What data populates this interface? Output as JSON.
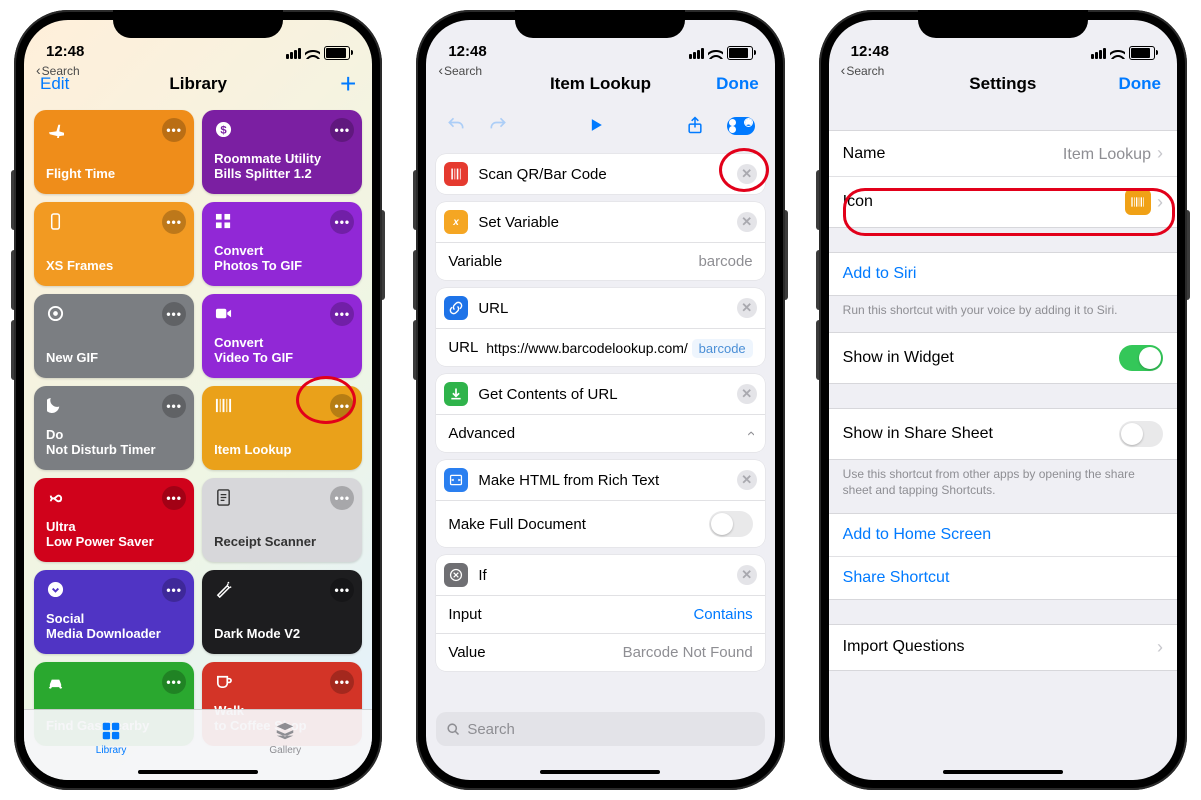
{
  "status": {
    "time": "12:48",
    "back": "Search"
  },
  "colors": {
    "orange1": "#ef8d1a",
    "orange2": "#f29a22",
    "purple": "#7b1fa2",
    "violet": "#9128d6",
    "grey": "#7b7e82",
    "amber": "#eaa11a",
    "red": "#d0021b",
    "greyL": "#d7d7da",
    "indigo": "#5034c4",
    "black": "#1d1d1f",
    "green": "#2aa82f",
    "red2": "#d33427",
    "scanRed": "#e53a2f",
    "setOrange": "#f5a623",
    "urlBlue": "#1e73e8",
    "getGreen": "#2fb34b",
    "htmlBlue": "#2a7ff0",
    "ifGrey": "#6f6f73"
  },
  "s1": {
    "edit": "Edit",
    "title": "Library",
    "add": "+",
    "tabs": {
      "library": "Library",
      "gallery": "Gallery"
    },
    "tiles": [
      {
        "label": "Flight Time",
        "color": "orange1",
        "icon": "plane"
      },
      {
        "label": "Roommate Utility\nBills Splitter 1.2",
        "color": "purple",
        "icon": "dollar"
      },
      {
        "label": "XS Frames",
        "color": "orange2",
        "icon": "phone"
      },
      {
        "label": "Convert\nPhotos To GIF",
        "color": "violet",
        "icon": "grid"
      },
      {
        "label": "New GIF",
        "color": "grey",
        "icon": "target"
      },
      {
        "label": "Convert\nVideo To GIF",
        "color": "violet",
        "icon": "video"
      },
      {
        "label": "Do\nNot Disturb Timer",
        "color": "grey",
        "icon": "moon"
      },
      {
        "label": "Item Lookup",
        "color": "amber",
        "icon": "barcode"
      },
      {
        "label": "Ultra\nLow Power Saver",
        "color": "red",
        "icon": "inf"
      },
      {
        "label": "Receipt Scanner",
        "color": "greyL",
        "icon": "doc",
        "dark": true
      },
      {
        "label": "Social\nMedia Downloader",
        "color": "indigo",
        "icon": "chev"
      },
      {
        "label": "Dark Mode V2",
        "color": "black",
        "icon": "wand"
      },
      {
        "label": "Find Gas Nearby",
        "color": "green",
        "icon": "car"
      },
      {
        "label": "Walk\nto Coffee Shop",
        "color": "red2",
        "icon": "cup"
      }
    ]
  },
  "s2": {
    "title": "Item Lookup",
    "done": "Done",
    "search": "Search",
    "actions": [
      {
        "icon": "scan",
        "color": "scanRed",
        "title": "Scan QR/Bar Code"
      },
      {
        "icon": "var",
        "color": "setOrange",
        "title": "Set Variable",
        "rows": [
          {
            "k": "Variable",
            "v": "barcode"
          }
        ]
      },
      {
        "icon": "link",
        "color": "urlBlue",
        "title": "URL",
        "rows": [
          {
            "k": "URL",
            "v": "https://www.barcodelookup.com/",
            "pill": "barcode"
          }
        ]
      },
      {
        "icon": "down",
        "color": "getGreen",
        "title": "Get Contents of URL",
        "rows": [
          {
            "k": "Advanced",
            "chev": true
          }
        ]
      },
      {
        "icon": "html",
        "color": "htmlBlue",
        "title": "Make HTML from Rich Text",
        "rows": [
          {
            "k": "Make Full Document",
            "toggle": false
          }
        ]
      },
      {
        "icon": "if",
        "color": "ifGrey",
        "title": "If",
        "rows": [
          {
            "k": "Input",
            "v": "Contains",
            "link": true
          },
          {
            "k": "Value",
            "v": "Barcode Not Found"
          }
        ]
      }
    ]
  },
  "s3": {
    "title": "Settings",
    "done": "Done",
    "name": {
      "label": "Name",
      "value": "Item Lookup"
    },
    "icon": {
      "label": "Icon"
    },
    "siri": {
      "label": "Add to Siri",
      "footer": "Run this shortcut with your voice by adding it to Siri."
    },
    "widget": {
      "label": "Show in Widget",
      "on": true
    },
    "share": {
      "label": "Show in Share Sheet",
      "on": false,
      "footer": "Use this shortcut from other apps by opening the share sheet and tapping Shortcuts."
    },
    "home": {
      "label": "Add to Home Screen"
    },
    "shareShortcut": {
      "label": "Share Shortcut"
    },
    "import": {
      "label": "Import Questions"
    }
  }
}
